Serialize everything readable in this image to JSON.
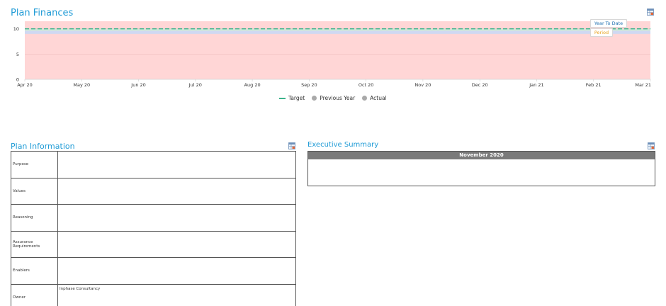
{
  "finances": {
    "title": "Plan Finances",
    "toggles": {
      "ytd": "Year To Date",
      "period": "Period"
    },
    "legend": [
      "Target",
      "Previous Year",
      "Actual"
    ]
  },
  "chart_data": {
    "type": "area",
    "categories": [
      "Apr 20",
      "May 20",
      "Jun 20",
      "Jul 20",
      "Aug 20",
      "Sep 20",
      "Oct 20",
      "Nov 20",
      "Dec 20",
      "Jan 21",
      "Feb 21",
      "Mar 21"
    ],
    "y_ticks": [
      0,
      5,
      10
    ],
    "ylim": [
      0,
      11.5
    ],
    "bands": [
      {
        "from": 0,
        "to": 11.5,
        "color": "#ffd6d6"
      },
      {
        "from": 9.0,
        "to": 9.6,
        "color": "#cfd8f2"
      },
      {
        "from": 9.6,
        "to": 10.0,
        "color": "#cde8d8"
      }
    ],
    "series": [
      {
        "name": "Target",
        "values": [
          10,
          10,
          10,
          10,
          10,
          10,
          10,
          10,
          10,
          10,
          10,
          10
        ],
        "color": "#3bb38a",
        "dashed": true
      },
      {
        "name": "Previous Year",
        "values": [],
        "color": "#a9a9a9"
      },
      {
        "name": "Actual",
        "values": [],
        "color": "#a9a9a9"
      }
    ],
    "grid": true,
    "legend_position": "bottom-center"
  },
  "plan_info": {
    "title": "Plan Information",
    "rows": [
      {
        "label": "Purpose",
        "value": ""
      },
      {
        "label": "Values",
        "value": ""
      },
      {
        "label": "Reasoning",
        "value": ""
      },
      {
        "label": "Assurance Requirements",
        "value": ""
      },
      {
        "label": "Enablers",
        "value": ""
      },
      {
        "label": "Owner",
        "value": "Inphase Consultancy"
      }
    ]
  },
  "exec_summary": {
    "title": "Executive Summary",
    "month": "November 2020",
    "body": ""
  },
  "icons": {
    "export": "export-table-icon"
  },
  "colors": {
    "accent": "#1f9bd6",
    "header_gray": "#7a7a7a"
  }
}
